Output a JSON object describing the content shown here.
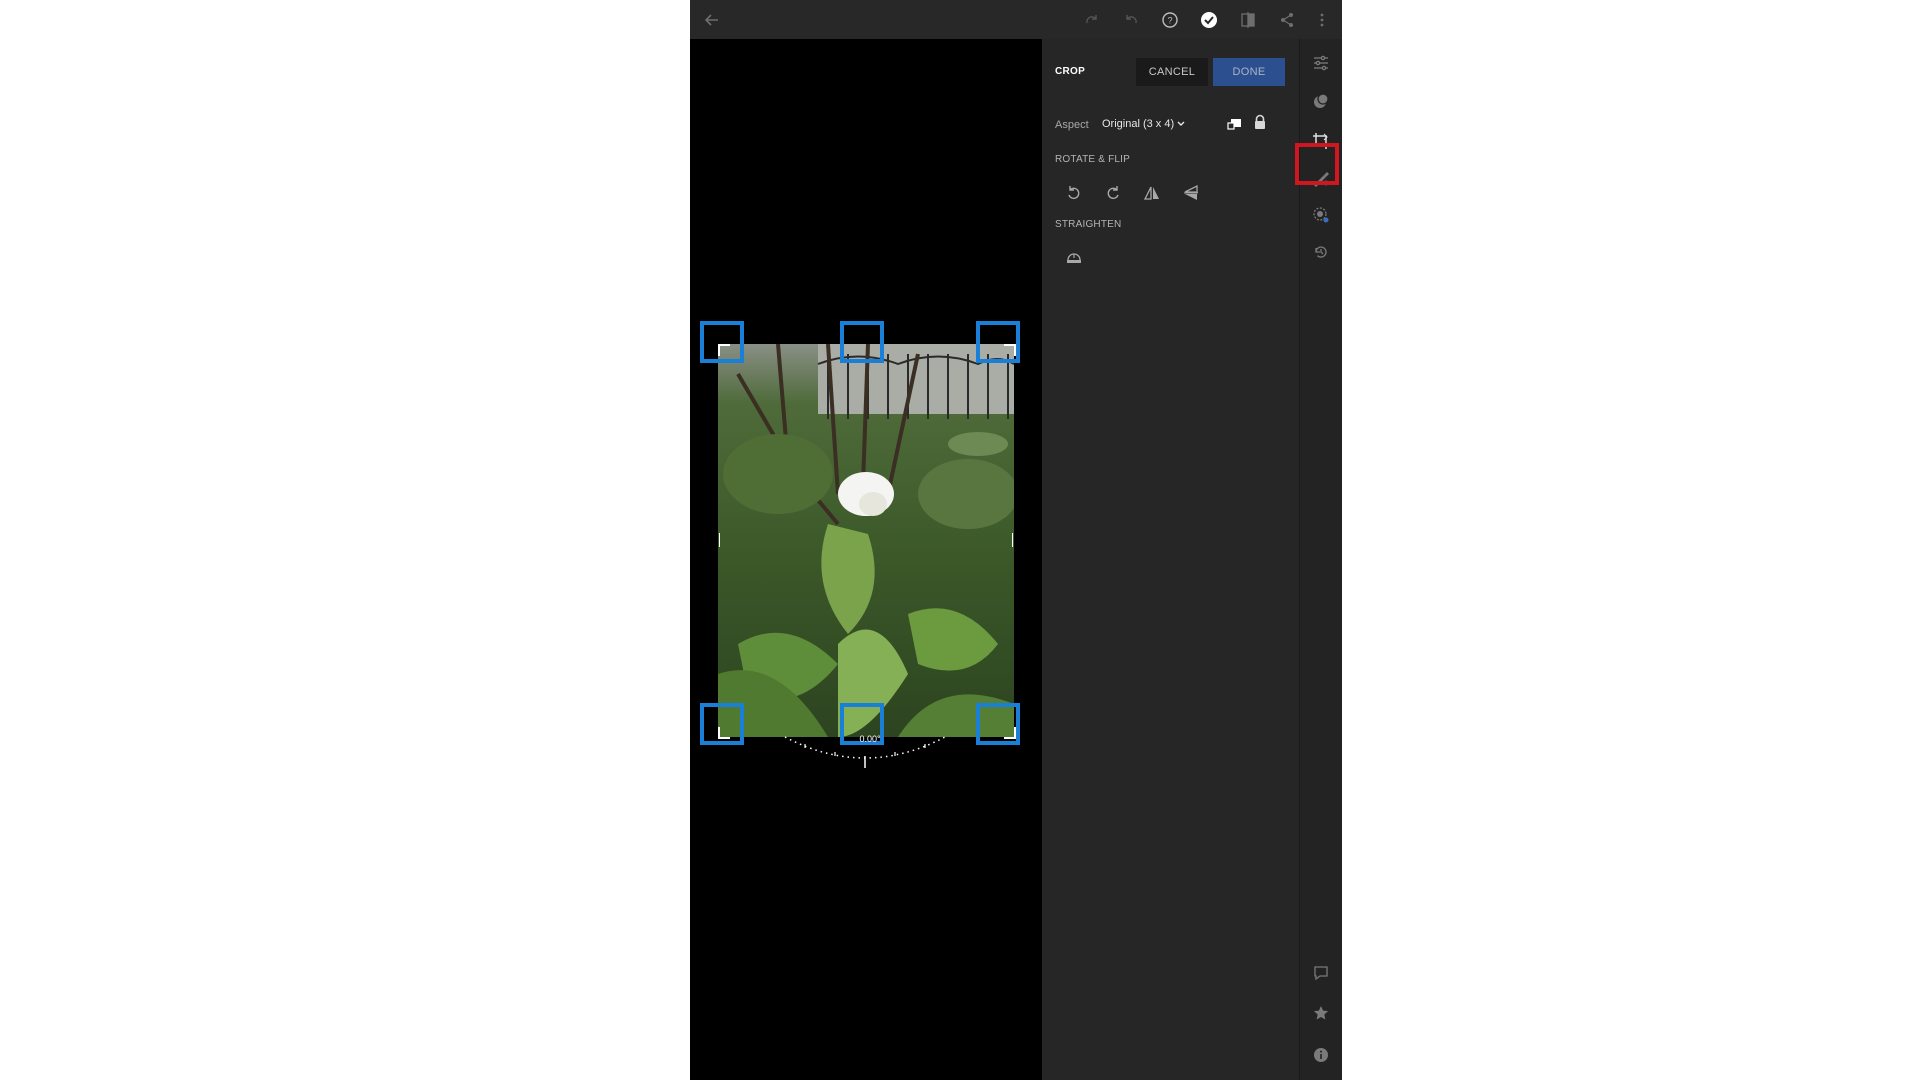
{
  "toolbar": {
    "icons": [
      "back-arrow-icon",
      "redo-icon",
      "undo-icon",
      "help-icon",
      "check-circle-icon",
      "compare-icon",
      "share-icon",
      "more-vertical-icon"
    ]
  },
  "crop_panel": {
    "title": "CROP",
    "cancel_label": "CANCEL",
    "done_label": "DONE",
    "aspect_label": "Aspect",
    "aspect_value": "Original (3 x 4)",
    "rotate_flip_label": "ROTATE & FLIP",
    "straighten_label": "STRAIGHTEN"
  },
  "canvas": {
    "angle_value": "0.00°"
  },
  "right_rail": {
    "icons": [
      "sliders-icon",
      "presets-icon",
      "crop-icon",
      "healing-brush-icon",
      "selective-icon",
      "history-icon",
      "comment-icon",
      "star-icon",
      "info-icon"
    ],
    "active": "crop-icon"
  },
  "colors": {
    "app_bg": "#1e1e1e",
    "done_button": "#2c4f8f",
    "handle_highlight": "#1a7fd6",
    "active_tool_highlight": "#d0161e"
  }
}
